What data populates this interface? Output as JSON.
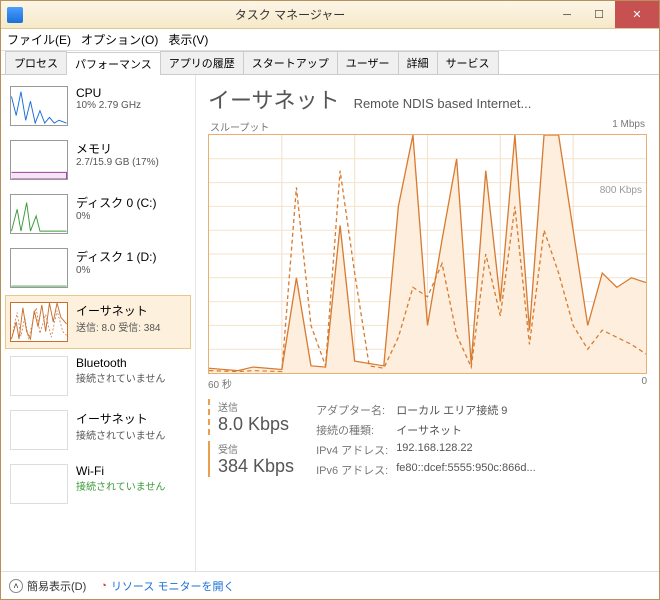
{
  "window": {
    "title": "タスク マネージャー"
  },
  "menu": {
    "file": "ファイル(E)",
    "options": "オプション(O)",
    "view": "表示(V)"
  },
  "tabs": [
    "プロセス",
    "パフォーマンス",
    "アプリの履歴",
    "スタートアップ",
    "ユーザー",
    "詳細",
    "サービス"
  ],
  "sidebar": {
    "items": [
      {
        "title": "CPU",
        "sub": "10% 2.79 GHz",
        "color": "#1a6fd8"
      },
      {
        "title": "メモリ",
        "sub": "2.7/15.9 GB (17%)",
        "color": "#9b3fa0"
      },
      {
        "title": "ディスク 0 (C:)",
        "sub": "0%",
        "color": "#3a9b3a"
      },
      {
        "title": "ディスク 1 (D:)",
        "sub": "0%",
        "color": "#3a9b3a"
      },
      {
        "title": "イーサネット",
        "sub": "送信: 8.0 受信: 384",
        "color": "#c87030"
      },
      {
        "title": "Bluetooth",
        "sub": "接続されていません",
        "color": "#ccc"
      },
      {
        "title": "イーサネット",
        "sub": "接続されていません",
        "color": "#ccc"
      },
      {
        "title": "Wi-Fi",
        "sub": "接続されていません",
        "color": "#ccc"
      }
    ]
  },
  "main": {
    "title": "イーサネット",
    "subtitle": "Remote NDIS based Internet...",
    "throughput_label": "スループット",
    "max_label": "1 Mbps",
    "mid_label": "800 Kbps",
    "axis_left": "60 秒",
    "axis_right": "0",
    "send_label": "送信",
    "send_value": "8.0 Kbps",
    "recv_label": "受信",
    "recv_value": "384 Kbps",
    "details": {
      "adapter_label": "アダプター名:",
      "adapter_value": "ローカル エリア接続 9",
      "type_label": "接続の種類:",
      "type_value": "イーサネット",
      "ipv4_label": "IPv4 アドレス:",
      "ipv4_value": "192.168.128.22",
      "ipv6_label": "IPv6 アドレス:",
      "ipv6_value": "fe80::dcef:5555:950c:866d..."
    }
  },
  "footer": {
    "simple": "簡易表示(D)",
    "resmon": "リソース モニターを開く"
  },
  "chart_data": {
    "type": "line",
    "xlabel": "60 秒 → 0",
    "ylabel": "スループット",
    "ylim": [
      0,
      1000
    ],
    "unit": "Kbps",
    "x": [
      0,
      2,
      4,
      6,
      8,
      10,
      12,
      14,
      16,
      18,
      20,
      22,
      24,
      26,
      28,
      30,
      32,
      34,
      36,
      38,
      40,
      42,
      44,
      46,
      48,
      50,
      52,
      54,
      56,
      58,
      60
    ],
    "series": [
      {
        "name": "受信",
        "style": "solid",
        "values": [
          20,
          15,
          10,
          25,
          20,
          15,
          400,
          30,
          25,
          620,
          50,
          40,
          30,
          700,
          1000,
          200,
          560,
          900,
          40,
          850,
          300,
          1000,
          180,
          1000,
          1000,
          600,
          200,
          420,
          360,
          400,
          380
        ]
      },
      {
        "name": "送信",
        "style": "dashed",
        "values": [
          10,
          8,
          6,
          10,
          8,
          6,
          780,
          200,
          30,
          850,
          420,
          30,
          20,
          150,
          360,
          320,
          460,
          160,
          25,
          500,
          240,
          700,
          120,
          600,
          420,
          200,
          100,
          180,
          150,
          120,
          80
        ]
      }
    ]
  }
}
